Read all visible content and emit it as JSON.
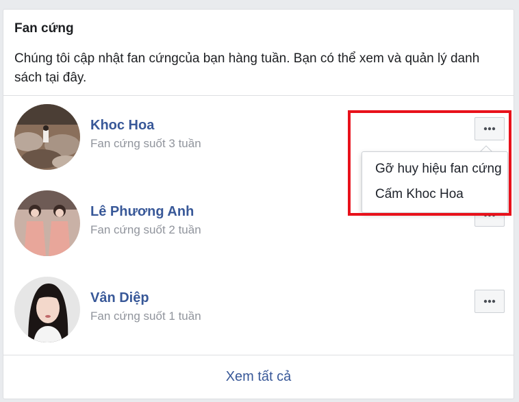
{
  "card": {
    "title": "Fan cứng",
    "description": "Chúng tôi cập nhật fan cứngcủa bạn hàng tuần. Bạn có thể xem và quản lý danh sách tại đây."
  },
  "fans": [
    {
      "name": "Khoc Hoa",
      "subtitle": "Fan cứng suốt 3 tuần"
    },
    {
      "name": "Lê Phương Anh",
      "subtitle": "Fan cứng suốt 2 tuần"
    },
    {
      "name": "Vân Diệp",
      "subtitle": "Fan cứng suốt 1 tuần"
    }
  ],
  "footer": {
    "see_all": "Xem tất cả"
  },
  "menu": {
    "items": [
      "Gỡ huy hiệu fan cứng",
      "Cấm Khoc Hoa"
    ]
  },
  "colors": {
    "link": "#385898",
    "secondary_text": "#90949c",
    "highlight": "#e8111b"
  },
  "icons": {
    "more": "more-dots-icon"
  }
}
